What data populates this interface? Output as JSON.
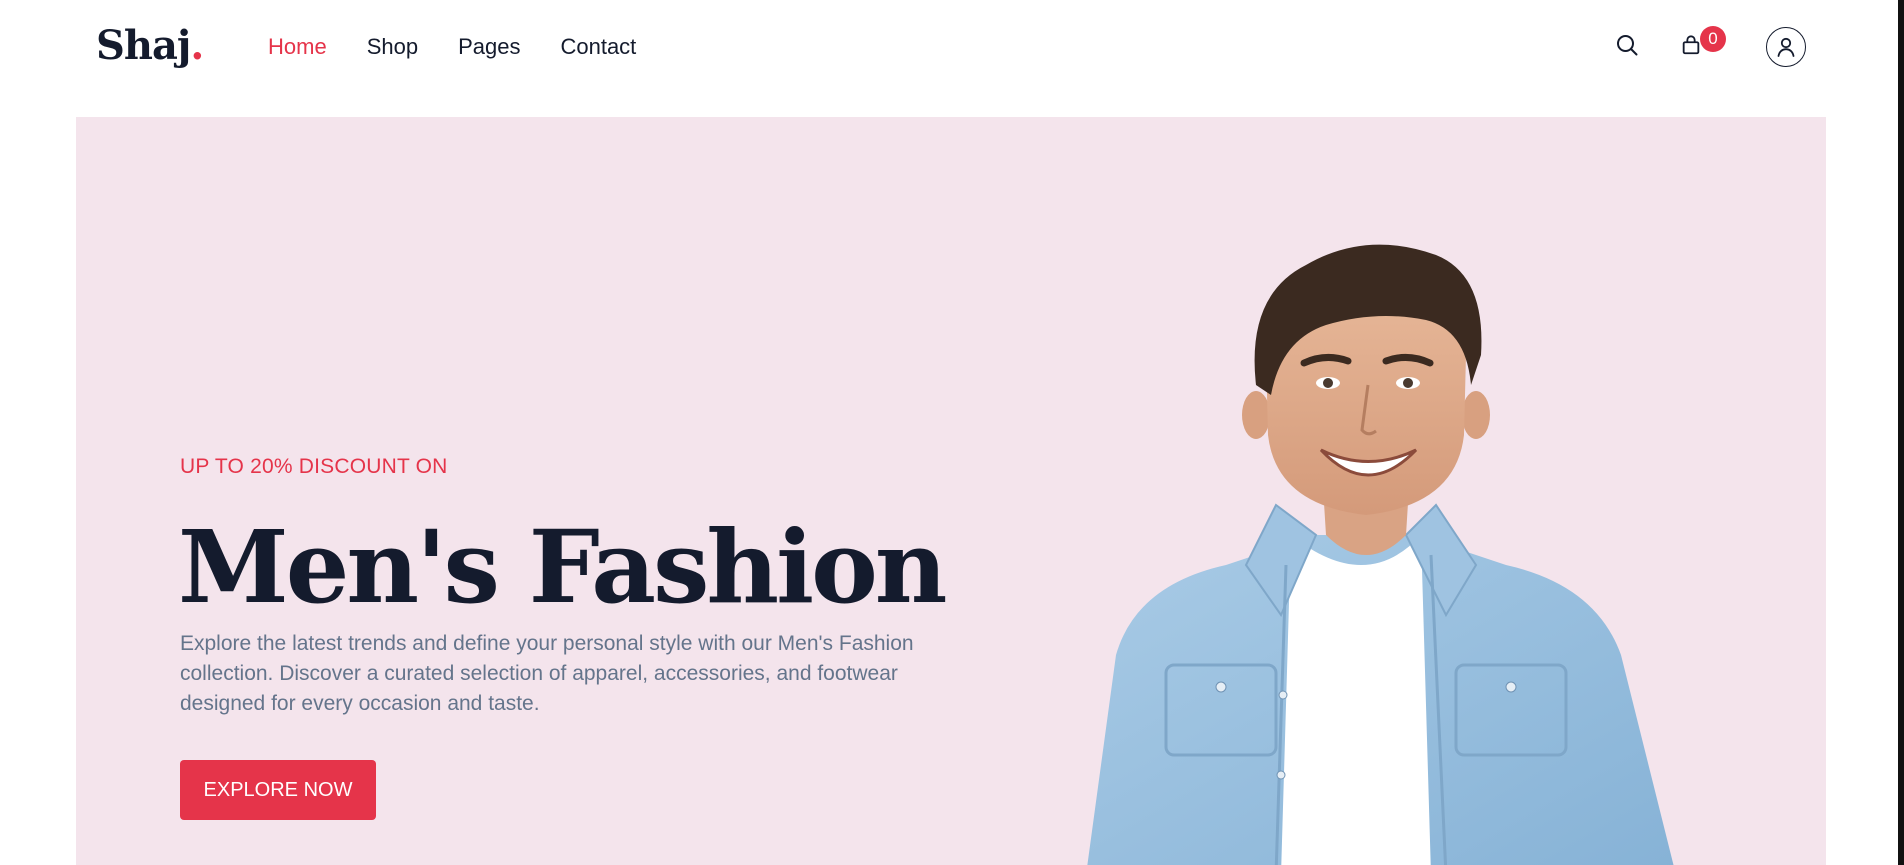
{
  "brand": {
    "name": "Shaj",
    "dot": "."
  },
  "nav": {
    "items": [
      {
        "label": "Home",
        "active": true
      },
      {
        "label": "Shop",
        "active": false
      },
      {
        "label": "Pages",
        "active": false
      },
      {
        "label": "Contact",
        "active": false
      }
    ]
  },
  "header_icons": {
    "search": "search-icon",
    "cart": "shopping-bag-icon",
    "user": "user-icon",
    "cart_count": "0"
  },
  "hero": {
    "eyebrow": "UP TO 20% DISCOUNT ON",
    "title": "Men's Fashion",
    "description": "Explore the latest trends and define your personal style with our Men's Fashion collection. Discover a curated selection of apparel, accessories, and footwear designed for every occasion and taste.",
    "cta_label": "EXPLORE NOW",
    "image": "smiling-man-denim-shirt"
  },
  "colors": {
    "accent": "#e5344a",
    "text_dark": "#141b2d",
    "text_muted": "#64748b",
    "hero_bg": "#f4e4ec"
  }
}
